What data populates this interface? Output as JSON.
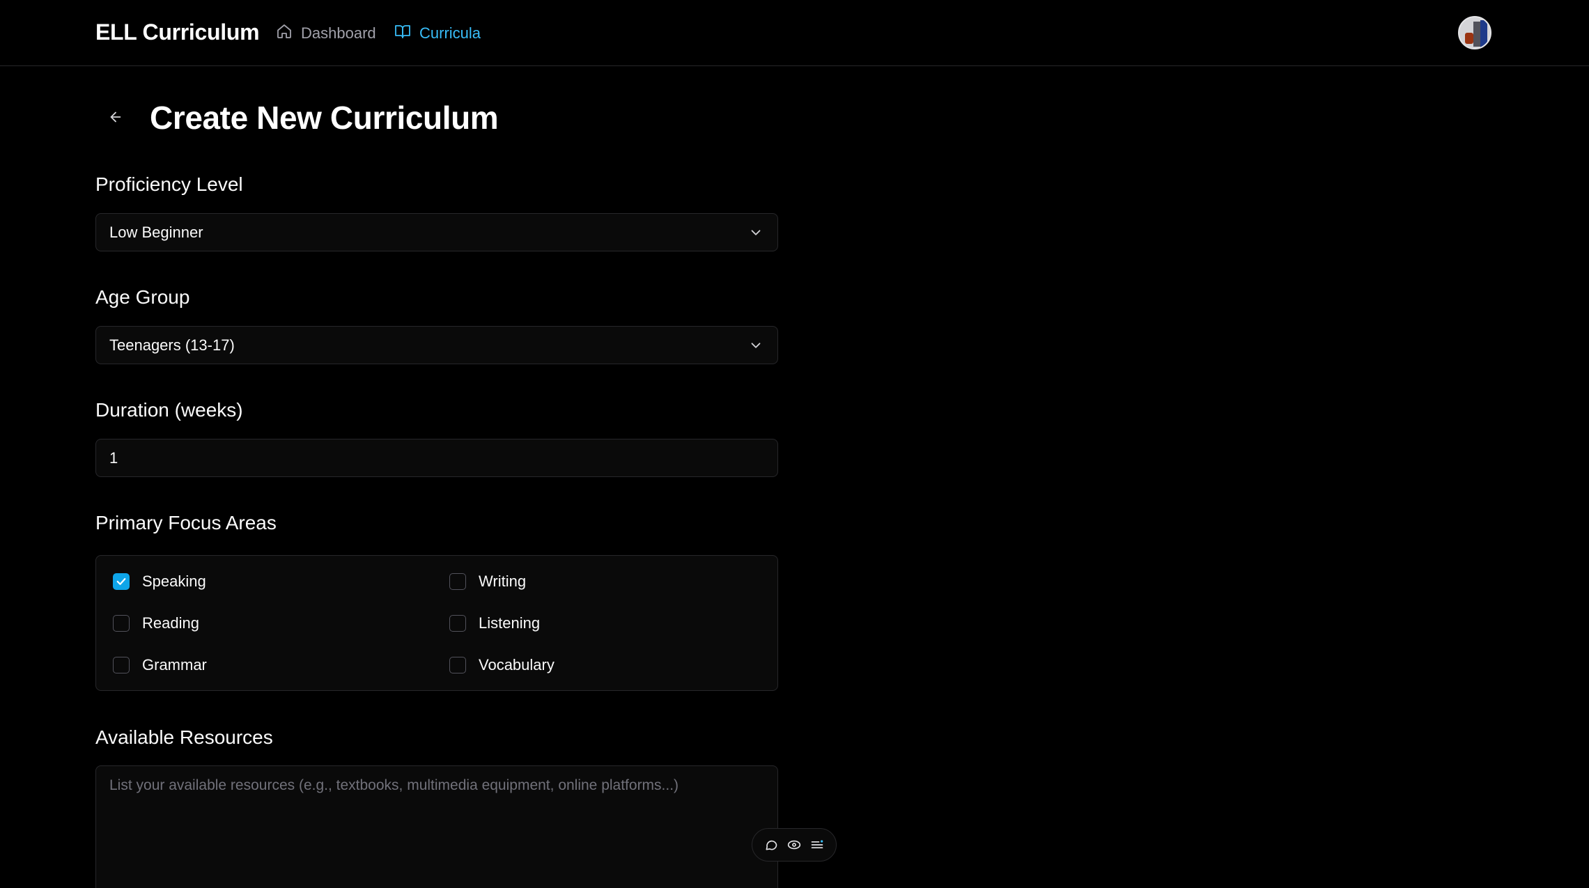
{
  "nav": {
    "brand": "ELL Curriculum",
    "links": [
      {
        "label": "Dashboard",
        "icon": "home-icon",
        "active": false
      },
      {
        "label": "Curricula",
        "icon": "book-open-icon",
        "active": true
      }
    ],
    "active_color": "#38bdf8"
  },
  "page": {
    "title": "Create New Curriculum"
  },
  "form": {
    "proficiency": {
      "label": "Proficiency Level",
      "value": "Low Beginner"
    },
    "age_group": {
      "label": "Age Group",
      "value": "Teenagers (13-17)"
    },
    "duration": {
      "label": "Duration (weeks)",
      "value": "1"
    },
    "focus": {
      "label": "Primary Focus Areas",
      "options": [
        {
          "label": "Speaking",
          "checked": true
        },
        {
          "label": "Writing",
          "checked": false
        },
        {
          "label": "Reading",
          "checked": false
        },
        {
          "label": "Listening",
          "checked": false
        },
        {
          "label": "Grammar",
          "checked": false
        },
        {
          "label": "Vocabulary",
          "checked": false
        }
      ]
    },
    "resources": {
      "label": "Available Resources",
      "placeholder": "List your available resources (e.g., textbooks, multimedia equipment, online platforms...)"
    }
  },
  "toolbar": {
    "icons": [
      "comment-icon",
      "eye-icon",
      "list-icon"
    ]
  }
}
